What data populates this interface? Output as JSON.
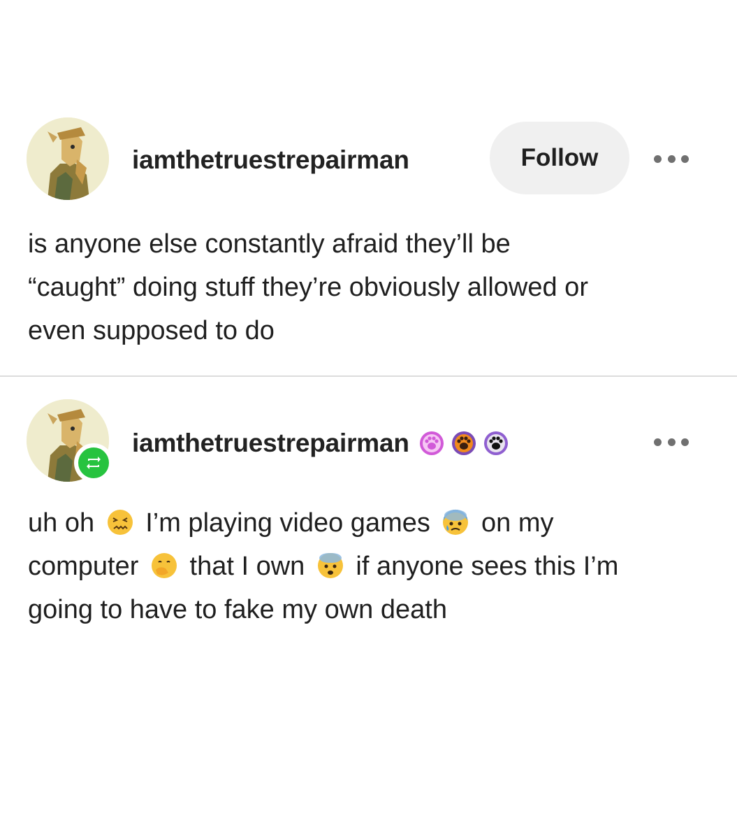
{
  "post1": {
    "username": "iamthetruestrepairman",
    "follow_label": "Follow",
    "lines": [
      "is anyone else constantly afraid they’ll be",
      "“caught” doing stuff they’re obviously allowed or",
      "even supposed to do"
    ]
  },
  "post2": {
    "username": "iamthetruestrepairman",
    "badges": [
      "paw-badge-pink-icon",
      "paw-badge-orange-icon",
      "paw-badge-purple-icon"
    ],
    "reblog_icon": "reblog-icon",
    "line1": {
      "a": "uh oh",
      "b": "I’m playing video games",
      "c": "on my"
    },
    "line2": {
      "a": "computer",
      "b": "that I own",
      "c": "if anyone sees this I’m"
    },
    "line3": "going to have to fake my own death",
    "emojis": [
      "confounded-face-emoji",
      "anxious-face-with-sweat-emoji",
      "face-with-hand-over-mouth-emoji",
      "fearful-face-emoji"
    ]
  },
  "colors": {
    "follow_bg": "#f0f0f0",
    "reblog_green": "#27c33f",
    "divider": "#dcdcdc",
    "text": "#1f1f1f"
  }
}
